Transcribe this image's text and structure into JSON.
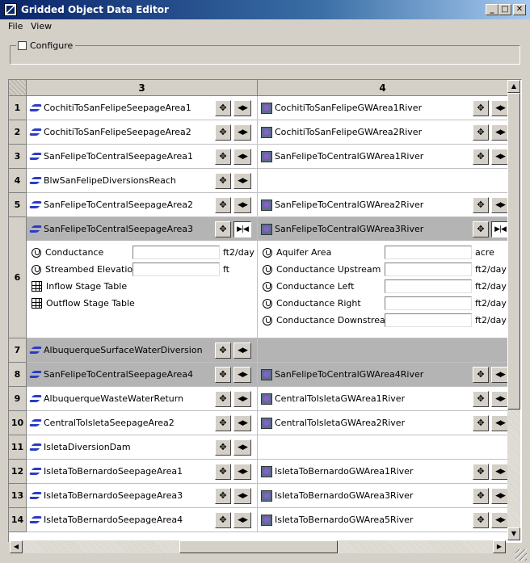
{
  "window": {
    "title": "Gridded Object Data Editor",
    "minimize": "_",
    "maximize": "□",
    "close": "✕"
  },
  "menu": {
    "file": "File",
    "view": "View"
  },
  "configure": {
    "label": "Configure",
    "checked": false
  },
  "grid": {
    "columns": [
      "3",
      "4"
    ],
    "rows": [
      {
        "num": "1",
        "c3": "CochitiToSanFelipeSeepageArea1",
        "c4": "CochitiToSanFelipeGWArea1River"
      },
      {
        "num": "2",
        "c3": "CochitiToSanFelipeSeepageArea2",
        "c4": "CochitiToSanFelipeGWArea2River"
      },
      {
        "num": "3",
        "c3": "SanFelipeToCentralSeepageArea1",
        "c4": "SanFelipeToCentralGWArea1River"
      },
      {
        "num": "4",
        "c3": "BlwSanFelipeDiversionsReach",
        "c4": ""
      },
      {
        "num": "5",
        "c3": "SanFelipeToCentralSeepageArea2",
        "c4": "SanFelipeToCentralGWArea2River"
      },
      {
        "num": "6",
        "c3": "SanFelipeToCentralSeepageArea3",
        "c4": "SanFelipeToCentralGWArea3River"
      },
      {
        "num": "7",
        "c3": "AlbuquerqueSurfaceWaterDiversion",
        "c4": ""
      },
      {
        "num": "8",
        "c3": "SanFelipeToCentralSeepageArea4",
        "c4": "SanFelipeToCentralGWArea4River"
      },
      {
        "num": "9",
        "c3": "AlbuquerqueWasteWaterReturn",
        "c4": "CentralToIsletaGWArea1River"
      },
      {
        "num": "10",
        "c3": "CentralToIsletaSeepageArea2",
        "c4": "CentralToIsletaGWArea2River"
      },
      {
        "num": "11",
        "c3": "IsletaDiversionDam",
        "c4": ""
      },
      {
        "num": "12",
        "c3": "IsletaToBernardoSeepageArea1",
        "c4": "IsletaToBernardoGWArea1River"
      },
      {
        "num": "13",
        "c3": "IsletaToBernardoSeepageArea3",
        "c4": "IsletaToBernardoGWArea3River"
      },
      {
        "num": "14",
        "c3": "IsletaToBernardoSeepageArea4",
        "c4": "IsletaToBernardoGWArea5River"
      }
    ],
    "expanded_c3": [
      {
        "label": "Conductance",
        "unit": "ft2/day",
        "kind": "slot",
        "value": ""
      },
      {
        "label": "Streambed Elevation",
        "unit": "ft",
        "kind": "slot",
        "value": ""
      },
      {
        "label": "Inflow Stage Table",
        "unit": "",
        "kind": "table"
      },
      {
        "label": "Outflow Stage Table",
        "unit": "",
        "kind": "table"
      }
    ],
    "expanded_c4": [
      {
        "label": "Aquifer Area",
        "unit": "acre",
        "value": ""
      },
      {
        "label": "Conductance Upstream",
        "unit": "ft2/day",
        "value": ""
      },
      {
        "label": "Conductance Left",
        "unit": "ft2/day",
        "value": ""
      },
      {
        "label": "Conductance Right",
        "unit": "ft2/day",
        "value": ""
      },
      {
        "label": "Conductance Downstream",
        "unit": "ft2/day",
        "value": ""
      }
    ],
    "icons": {
      "move": "✥",
      "expand": "◀▶",
      "collapse": "▶|◀"
    }
  }
}
